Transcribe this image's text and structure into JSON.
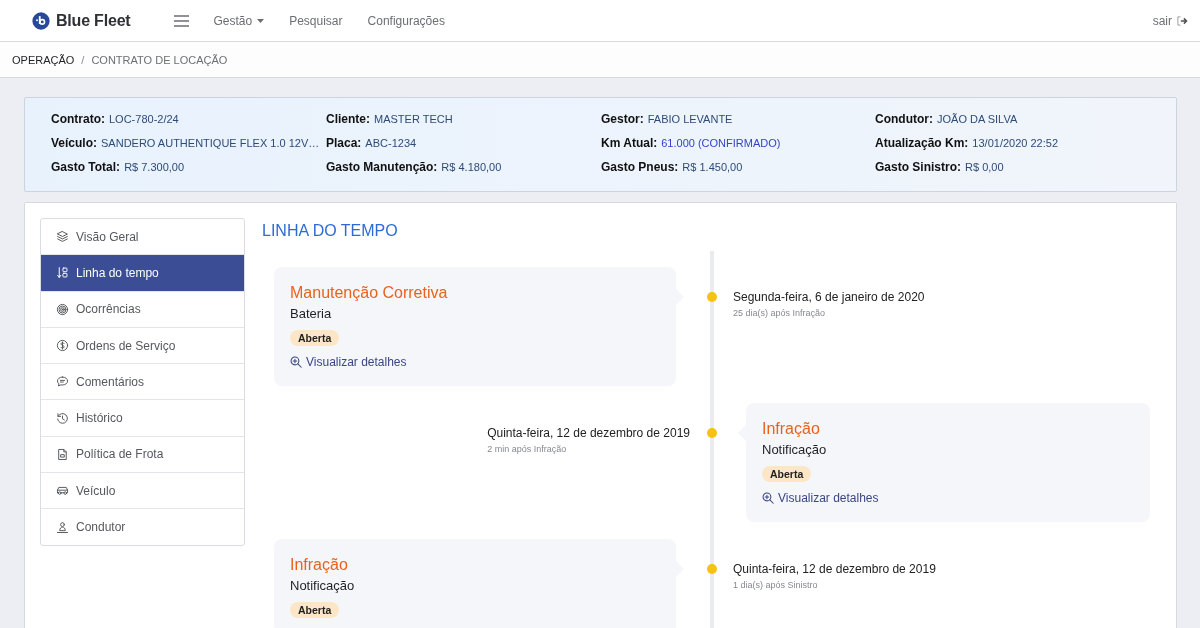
{
  "navbar": {
    "brand": "Blue Fleet",
    "links": [
      {
        "label": "Gestão",
        "dropdown": true
      },
      {
        "label": "Pesquisar",
        "dropdown": false
      },
      {
        "label": "Configurações",
        "dropdown": false
      }
    ],
    "logout": "sair"
  },
  "breadcrumb": {
    "separator": "/",
    "items": [
      {
        "label": "OPERAÇÃO",
        "current": false
      },
      {
        "label": "CONTRATO DE LOCAÇÃO",
        "current": true
      }
    ]
  },
  "contract_summary": {
    "fields": [
      {
        "label": "Contrato:",
        "value": "LOC-780-2/24",
        "highlighted": false
      },
      {
        "label": "Cliente:",
        "value": "MASTER TECH",
        "highlighted": false
      },
      {
        "label": "Gestor:",
        "value": "FABIO LEVANTE",
        "highlighted": false
      },
      {
        "label": "Condutor:",
        "value": "JOÃO DA SILVA",
        "highlighted": false
      },
      {
        "label": "Veículo:",
        "value": "SANDERO AUTHENTIQUE FLEX 1.0 12V…",
        "highlighted": false
      },
      {
        "label": "Placa:",
        "value": "ABC-1234",
        "highlighted": false
      },
      {
        "label": "Km Atual:",
        "value": "61.000 (CONFIRMADO)",
        "highlighted": true
      },
      {
        "label": "Atualização Km:",
        "value": "13/01/2020 22:52",
        "highlighted": false
      },
      {
        "label": "Gasto Total:",
        "value": "R$ 7.300,00",
        "highlighted": false
      },
      {
        "label": "Gasto Manutenção:",
        "value": "R$ 4.180,00",
        "highlighted": false
      },
      {
        "label": "Gasto Pneus:",
        "value": "R$ 1.450,00",
        "highlighted": false
      },
      {
        "label": "Gasto Sinistro:",
        "value": "R$ 0,00",
        "highlighted": false
      }
    ]
  },
  "side_menu": {
    "items": [
      {
        "label": "Visão Geral",
        "selected": false
      },
      {
        "label": "Linha do tempo",
        "selected": true
      },
      {
        "label": "Ocorrências",
        "selected": false
      },
      {
        "label": "Ordens de Serviço",
        "selected": false
      },
      {
        "label": "Comentários",
        "selected": false
      },
      {
        "label": "Histórico",
        "selected": false
      },
      {
        "label": "Política de Frota",
        "selected": false
      },
      {
        "label": "Veículo",
        "selected": false
      },
      {
        "label": "Condutor",
        "selected": false
      }
    ]
  },
  "timeline": {
    "title": "LINHA DO TEMPO",
    "events": [
      {
        "kind": "left",
        "title": "Manutenção Corretiva",
        "subtitle": "Bateria",
        "status": "Aberta",
        "link": "Visualizar detalhes",
        "date": "Segunda-feira, 6 de janeiro de 2020",
        "relative": "25 dia(s) após Infração"
      },
      {
        "kind": "right",
        "title": "Infração",
        "subtitle": "Notificação",
        "status": "Aberta",
        "link": "Visualizar detalhes",
        "date": "Quinta-feira, 12 de dezembro de 2019",
        "relative": "2 min após Infração"
      },
      {
        "kind": "left",
        "title": "Infração",
        "subtitle": "Notificação",
        "status": "Aberta",
        "date": "Quinta-feira, 12 de dezembro de 2019",
        "relative": "1 dia(s) após Sinistro"
      }
    ]
  }
}
